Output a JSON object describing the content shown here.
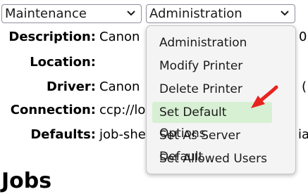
{
  "selects": {
    "maintenance": "Maintenance",
    "administration": "Administration"
  },
  "printer_info": {
    "description_label": "Description:",
    "description_value": "Canon",
    "description_trailing": "0",
    "location_label": "Location:",
    "location_value": "",
    "driver_label": "Driver:",
    "driver_value": "Canon",
    "driver_trailing": "(",
    "connection_label": "Connection:",
    "connection_value": "ccp://lo",
    "defaults_label": "Defaults:",
    "defaults_value": "job-she",
    "defaults_trailing": "ia"
  },
  "jobs_heading": "Jobs",
  "admin_menu": {
    "options": [
      "Administration",
      "Modify Printer",
      "Delete Printer",
      "Set Default Options",
      "Set As Server Default",
      "Set Allowed Users"
    ],
    "highlighted_index": 3,
    "highlight_color": "#d7f0d3"
  },
  "annotation": {
    "arrow_color": "#e8231f"
  }
}
